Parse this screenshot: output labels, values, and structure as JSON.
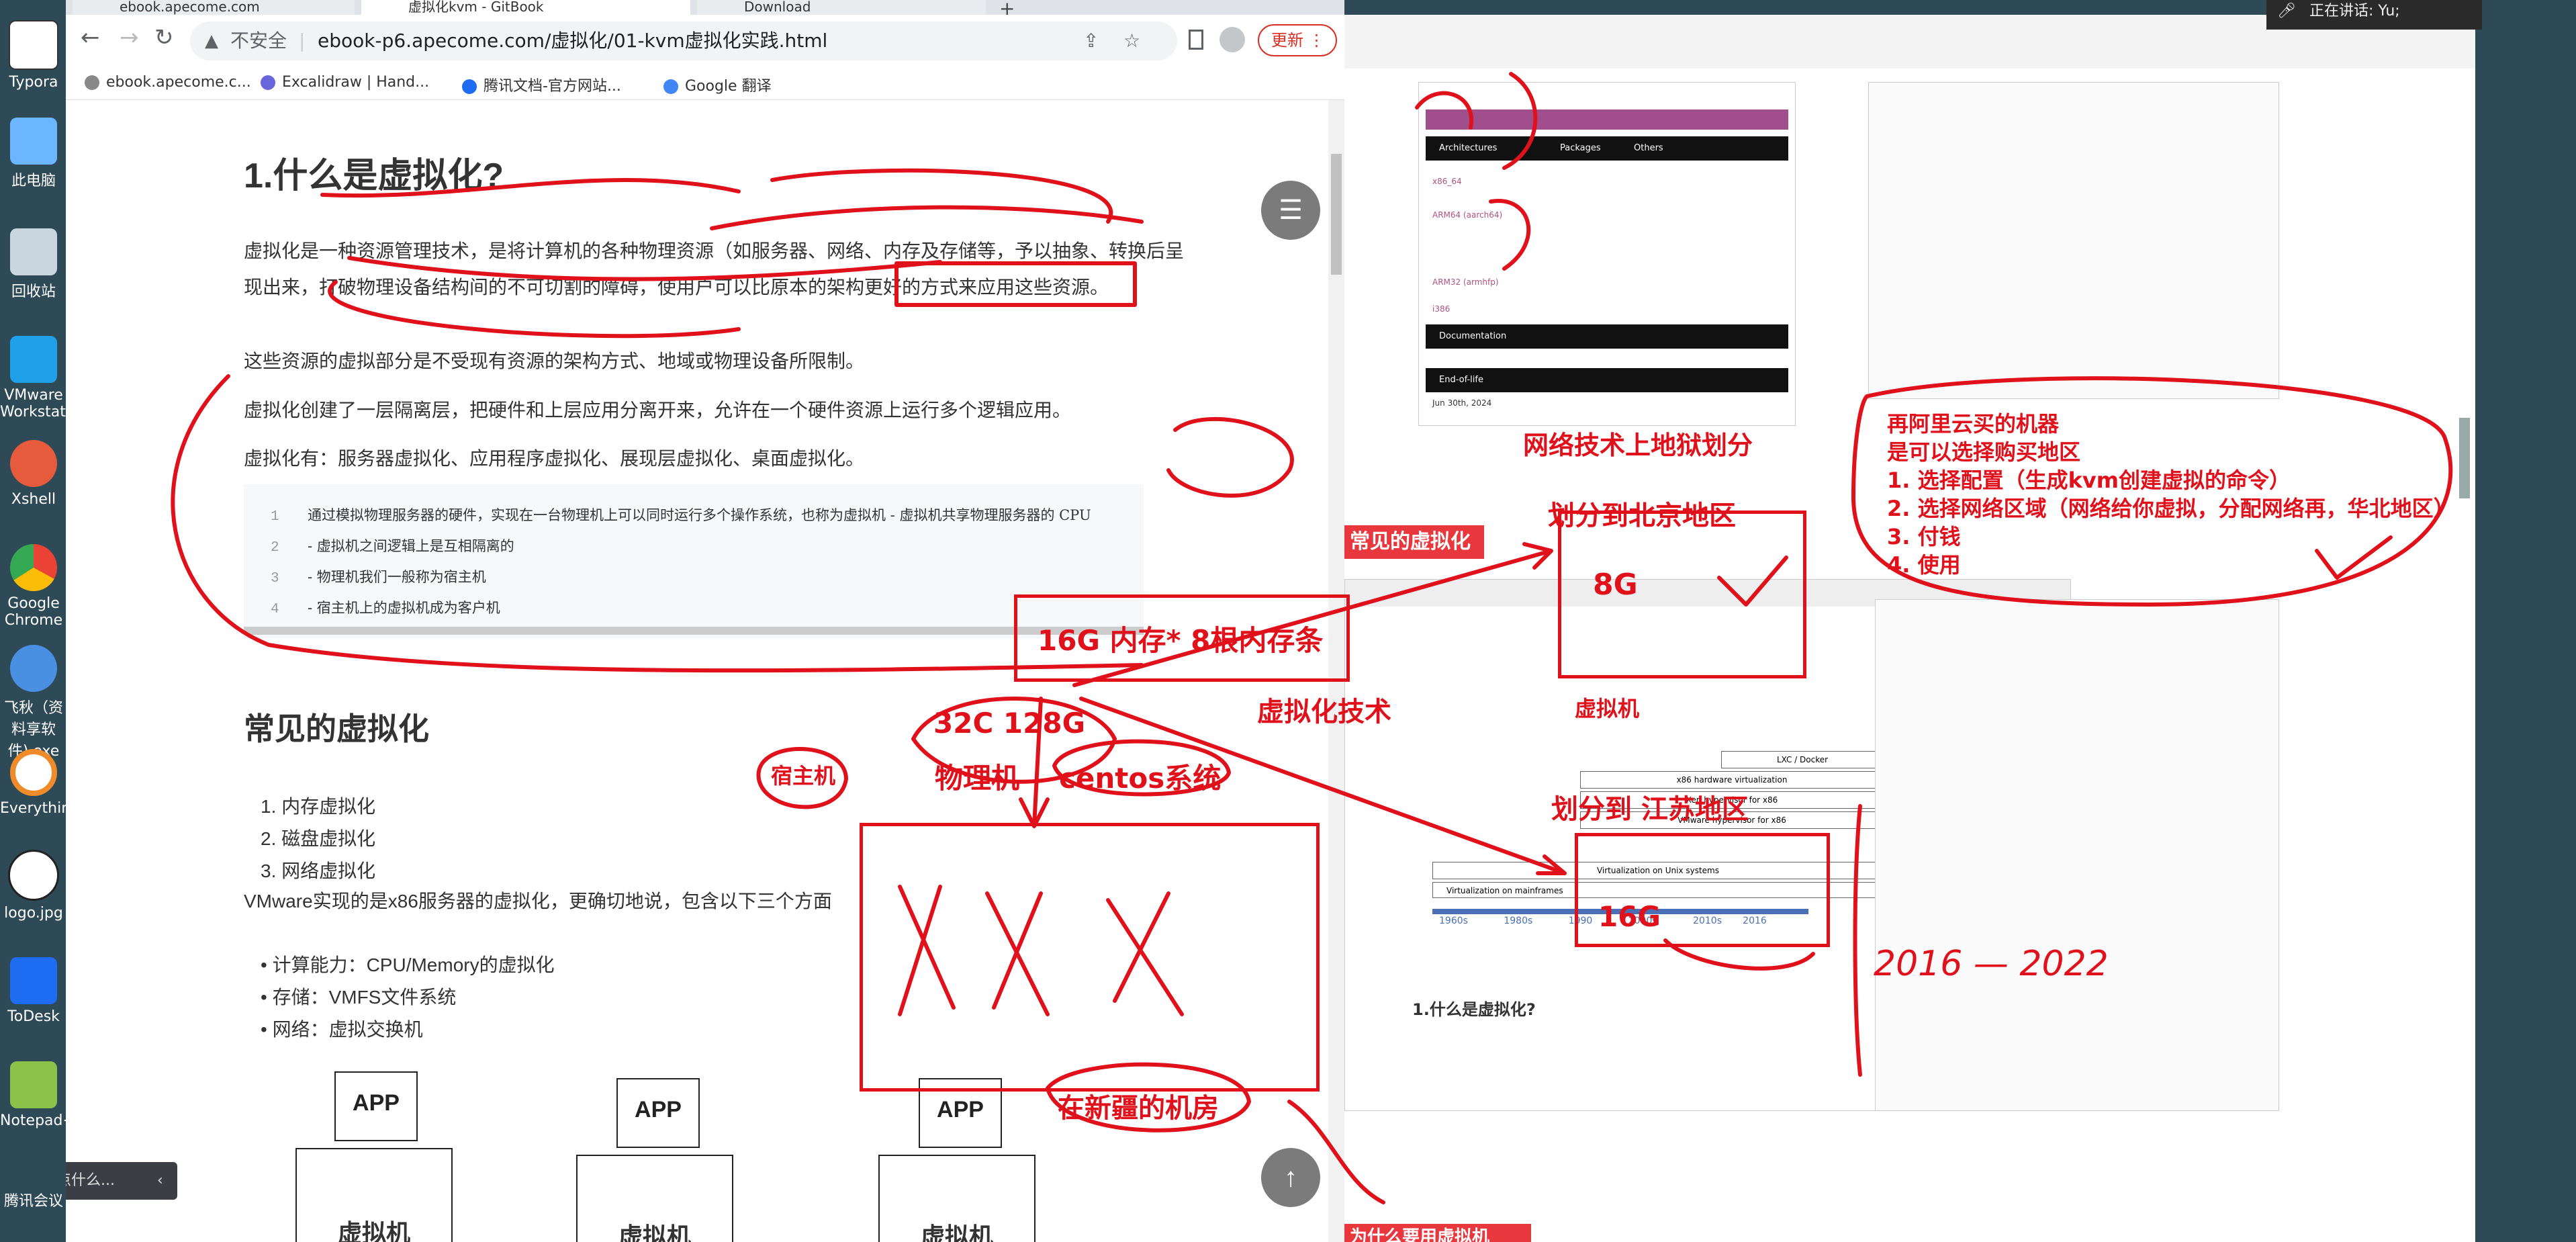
{
  "desktop": {
    "icons": [
      {
        "label": "Typora",
        "color": "#ffffff"
      },
      {
        "label": "此电脑",
        "color": "#6bb6ff"
      },
      {
        "label": "回收站",
        "color": "#c9d6df"
      },
      {
        "label": "VMware Workstat...",
        "color": "#1fa0e8"
      },
      {
        "label": "Xshell",
        "color": "#e55b3c"
      },
      {
        "label": "Google Chrome",
        "color": "#34a853"
      },
      {
        "label": "飞秋（资料享软件).exe",
        "color": "#4a90e2"
      },
      {
        "label": "Everythin...",
        "color": "#f08b2a"
      },
      {
        "label": "logo.jpg",
        "color": "#222222"
      },
      {
        "label": "ToDesk",
        "color": "#1e6cf2"
      },
      {
        "label": "Notepad++",
        "color": "#8bc34a"
      },
      {
        "label": "腾讯会议",
        "color": "#2d7cf6"
      }
    ]
  },
  "browser": {
    "tabs": [
      {
        "label": "ebook.apecome.com"
      },
      {
        "label": "虚拟化kvm - GitBook"
      },
      {
        "label": "Download"
      }
    ],
    "address": {
      "security": "不安全",
      "url": "ebook-p6.apecome.com/虚拟化/01-kvm虚拟化实践.html"
    },
    "update_label": "更新",
    "bookmarks": [
      "ebook.apecome.c...",
      "Excalidraw | Hand...",
      "腾讯文档-官方网站...",
      "Google 翻译"
    ]
  },
  "article": {
    "h1": "1.什么是虚拟化?",
    "p1": "虚拟化是一种资源管理技术，是将计算机的各种物理资源（如服务器、网络、内存及存储等，予以抽象、转换后呈现出来，打破物理设备结构间的不可切割的障碍，使用户可以比原本的架构更好的方式来应用这些资源。",
    "p2": "这些资源的虚拟部分是不受现有资源的架构方式、地域或物理设备所限制。",
    "p3": "虚拟化创建了一层隔离层，把硬件和上层应用分离开来，允许在一个硬件资源上运行多个逻辑应用。",
    "p4": "虚拟化有：服务器虚拟化、应用程序虚拟化、展现层虚拟化、桌面虚拟化。",
    "code": [
      {
        "n": "1",
        "t": "通过模拟物理服务器的硬件，实现在一台物理机上可以同时运行多个操作系统，也称为虚拟机 - 虚拟机共享物理服务器的 CPU"
      },
      {
        "n": "2",
        "t": "- 虚拟机之间逻辑上是互相隔离的"
      },
      {
        "n": "3",
        "t": "- 物理机我们一般称为宿主机"
      },
      {
        "n": "4",
        "t": "- 宿主机上的虚拟机成为客户机"
      }
    ],
    "h2": "常见的虚拟化",
    "ol": [
      "1. 内存虚拟化",
      "2. 磁盘虚拟化",
      "3. 网络虚拟化"
    ],
    "p5": "VMware实现的是x86服务器的虚拟化，更确切地说，包含以下三个方面",
    "ul": [
      "• 计算能力：CPU/Memory的虚拟化",
      "• 存储：VMFS文件系统",
      "• 网络：虚拟交换机"
    ],
    "app_label": "APP",
    "vm_label": "虚拟机"
  },
  "chat_bar": {
    "placeholder": "说点什么..."
  },
  "meeting": {
    "speaking": "正在讲话: Yu;"
  },
  "annotations": {
    "network_title": "网络技术上地狱划分",
    "beijing": "划分到北京地区",
    "jiangsu": "划分到 江苏地区",
    "aliyun": [
      "再阿里云买的机器",
      "是可以选择购买地区",
      "1. 选择配置（生成kvm创建虚拟的命令）",
      "2. 选择网络区域（网络给你虚拟，分配网络再，华北地区）",
      "3. 付钱",
      "4. 使用"
    ],
    "mem": "16G 内存* 8根内存条",
    "virt_tech": "虚拟化技术",
    "vm_word": "虚拟机",
    "cpu": "32C 128G",
    "host": "宿主机",
    "physical": "物理机",
    "centos": "centos系统",
    "eightg": "8G",
    "sixteeng": "16G",
    "xinjiang": "在新疆的机房",
    "years": "2016 — 2022",
    "common": "常见的虚拟化",
    "why": "为什么要用虚拟机"
  },
  "right_panel": {
    "table_rows": [
      "x86_64",
      "ARM64 (aarch64)",
      "ARM32 (armhfp)",
      "i386"
    ],
    "cols": [
      "Architectures",
      "Packages",
      "Others"
    ],
    "doc_title": "Documentation",
    "eol": "End-of-life",
    "eol_date": "Jun 30th, 2024",
    "timeline": [
      "1960s",
      "1980s",
      "1990",
      "2000s",
      "2010s",
      "2016"
    ],
    "stack": [
      "LXC / Docker",
      "x86 hardware virtualization",
      "Xen hypervisor for x86",
      "VMware hypervisor for x86",
      "Virtualization on Unix systems",
      "Virtualization on mainframes"
    ],
    "article_h": "1.什么是虚拟化?"
  }
}
